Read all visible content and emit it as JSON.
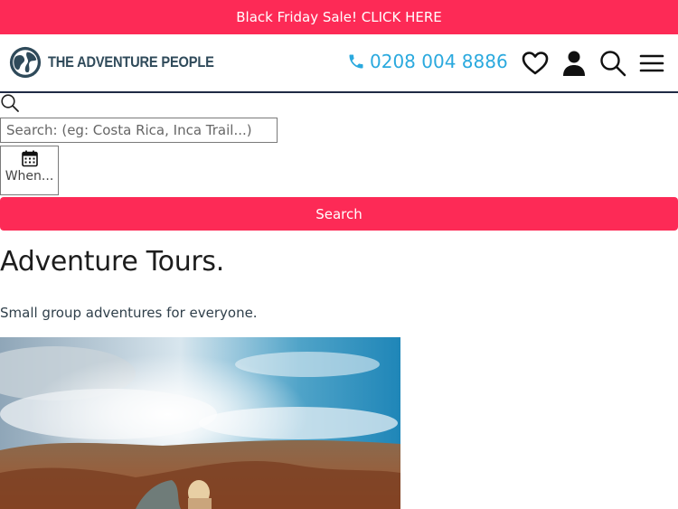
{
  "promo": {
    "text": "Black Friday Sale! CLICK HERE"
  },
  "header": {
    "logo_text": "THE ADVENTURE PEOPLE",
    "phone": "0208 004 8886",
    "icons": [
      "phone-icon",
      "heart-icon",
      "user-icon",
      "search-icon",
      "menu-icon"
    ]
  },
  "search": {
    "placeholder": "Search: (eg: Costa Rica, Inca Trail...)",
    "when_label": "When...",
    "button_label": "Search"
  },
  "hero": {
    "title": "Adventure Tours.",
    "subtitle": "Small group adventures for everyone."
  },
  "colors": {
    "accent": "#fd2a56",
    "phone": "#2aa9de",
    "logo": "#2f4a5a"
  }
}
